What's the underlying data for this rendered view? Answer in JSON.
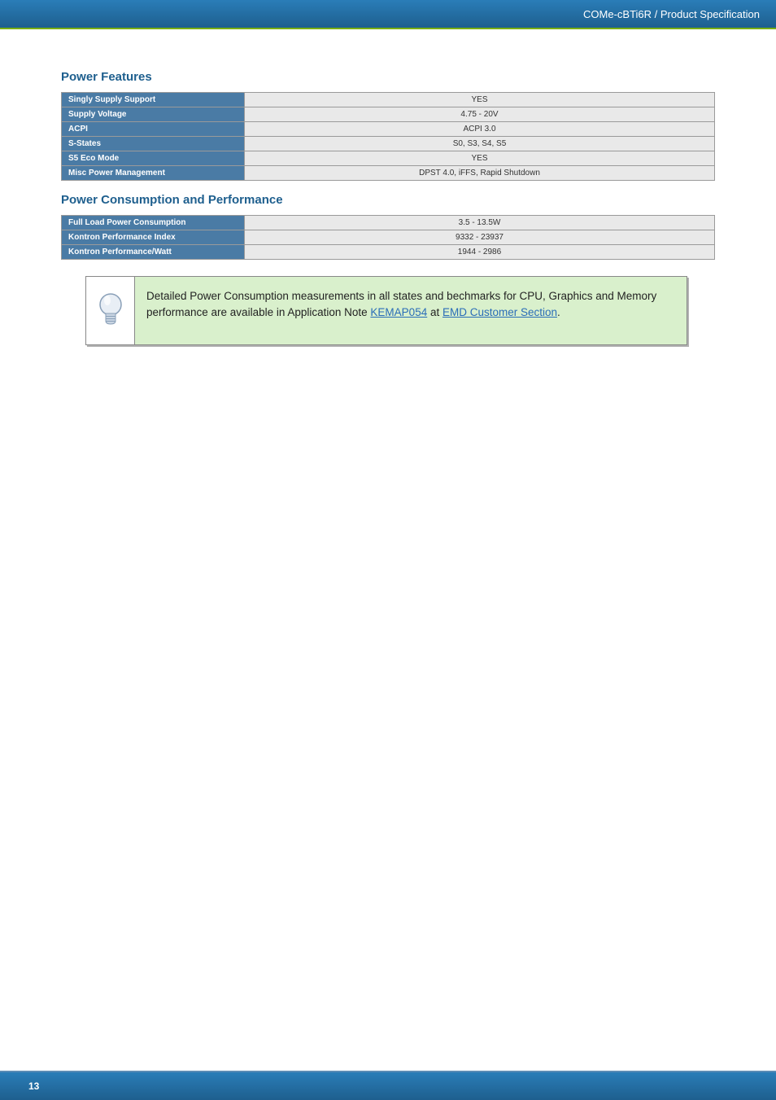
{
  "header": {
    "breadcrumb": "COMe-cBTi6R / Product Specification"
  },
  "sections": {
    "power_features": {
      "title": "Power Features",
      "rows": [
        {
          "label": "Singly Supply Support",
          "value": "YES"
        },
        {
          "label": "Supply Voltage",
          "value": "4.75 - 20V"
        },
        {
          "label": "ACPI",
          "value": "ACPI 3.0"
        },
        {
          "label": "S-States",
          "value": "S0, S3, S4, S5"
        },
        {
          "label": "S5 Eco Mode",
          "value": "YES"
        },
        {
          "label": "Misc Power Management",
          "value": "DPST 4.0, iFFS, Rapid Shutdown"
        }
      ]
    },
    "power_consumption": {
      "title": "Power Consumption and Performance",
      "rows": [
        {
          "label": "Full Load Power Consumption",
          "value": "3.5 - 13.5W"
        },
        {
          "label": "Kontron Performance Index",
          "value": "9332 - 23937"
        },
        {
          "label": "Kontron Performance/Watt",
          "value": "1944 - 2986"
        }
      ]
    }
  },
  "note": {
    "prefix": "Detailed Power Consumption measurements in all states and bechmarks for CPU, Graphics and Memory performance are available in Application Note ",
    "link1": "KEMAP054",
    "middle": " at ",
    "link2": "EMD Customer Section",
    "suffix": "."
  },
  "footer": {
    "page_number": "13"
  }
}
